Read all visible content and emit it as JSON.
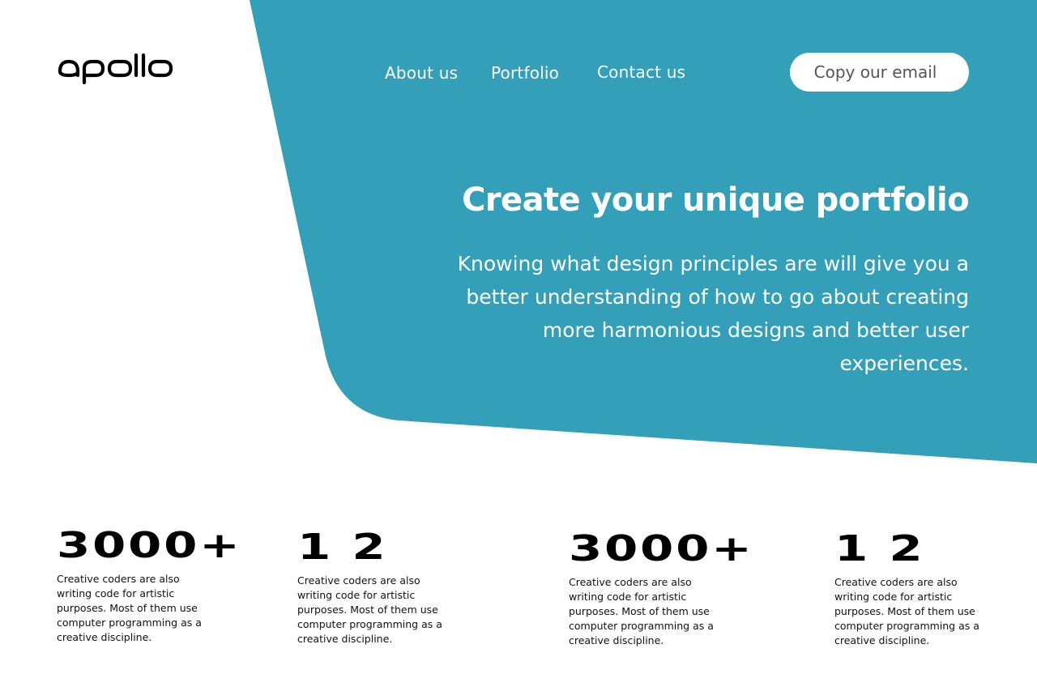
{
  "brand": {
    "logo_text": "apollo",
    "accent_color": "#339fb8"
  },
  "nav": {
    "about": "About us",
    "portfolio": "Portfolio",
    "contact": "Contact us"
  },
  "cta": {
    "copy_email": "Copy our email"
  },
  "hero": {
    "title": "Create your unique portfolio",
    "subtitle_lines": [
      "Knowing what design principles are will give you a",
      "better understanding of how to go about creating",
      "more harmonious designs and better user",
      "experiences."
    ]
  },
  "stats": [
    {
      "number": "3000+",
      "desc_lines": [
        "Creative coders are also",
        "writing code for artistic",
        "purposes. Most of them use",
        "computer programming as a",
        "creative discipline."
      ]
    },
    {
      "number": "1 2",
      "desc_lines": [
        "Creative coders are also",
        "writing code for artistic",
        "purposes. Most of them use",
        "computer programming as a",
        "creative discipline."
      ]
    },
    {
      "number": "3000+",
      "desc_lines": [
        "Creative coders are also",
        "writing code for artistic",
        "purposes. Most of them use",
        "computer programming as a",
        "creative discipline."
      ]
    },
    {
      "number": "1 2",
      "desc_lines": [
        "Creative coders are also",
        "writing code for artistic",
        "purposes. Most of them use",
        "computer programming as a",
        "creative discipline."
      ]
    }
  ]
}
